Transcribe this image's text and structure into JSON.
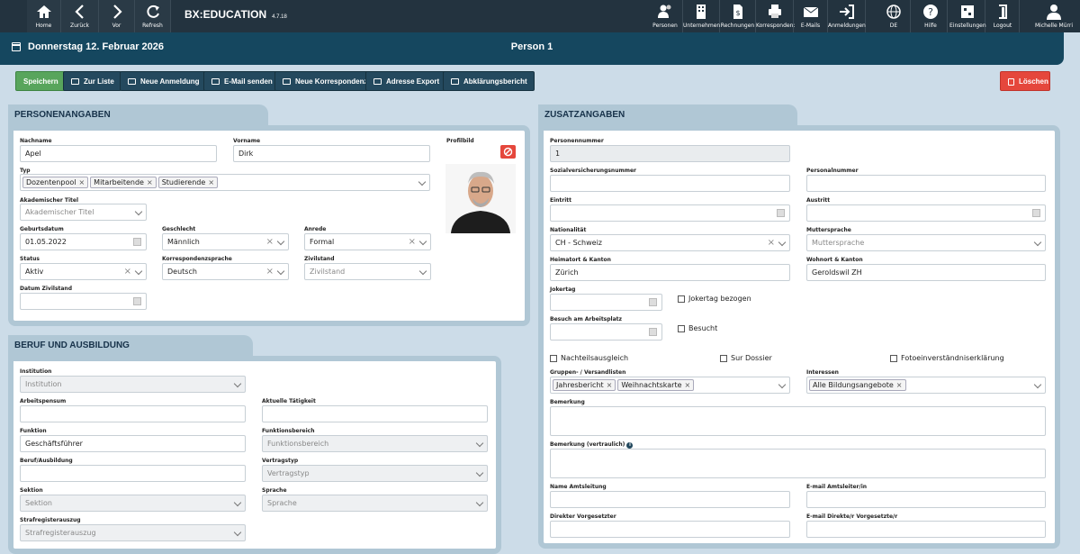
{
  "topbar": {
    "nav": [
      {
        "label": "Home",
        "icon": "home-icon"
      },
      {
        "label": "Zurück",
        "icon": "back-icon"
      },
      {
        "label": "Vor",
        "icon": "forward-icon"
      },
      {
        "label": "Refresh",
        "icon": "refresh-icon"
      }
    ],
    "brand": "BX:EDUCATION",
    "version": "4.7.18",
    "modules": [
      "Personen",
      "Unternehmen",
      "Rechnungen",
      "Korresponden:",
      "E-Mails",
      "Anmeldungen"
    ],
    "right": [
      "DE",
      "Hilfe",
      "Einstellungen",
      "Logout"
    ],
    "user": "Michelle Mürri"
  },
  "header": {
    "date": "Donnerstag 12. Februar 2026",
    "title": "Person 1"
  },
  "toolbar": {
    "save": "Speichern",
    "to_list": "Zur Liste",
    "new_registration": "Neue Anmeldung",
    "send_email": "E-Mail senden",
    "new_correspondence": "Neue Korrespondenz",
    "export_address": "Adresse Export",
    "clarification_report": "Abklärungsbericht",
    "delete": "Löschen"
  },
  "personal": {
    "title": "PERSONENANGABEN",
    "labels": {
      "lastname": "Nachname",
      "firstname": "Vorname",
      "profile": "Profilbild",
      "type": "Typ",
      "title": "Akademischer Titel",
      "birth": "Geburtsdatum",
      "gender": "Geschlecht",
      "salutation": "Anrede",
      "status": "Status",
      "corr_lang": "Korrespondenzsprache",
      "civil": "Zivilstand",
      "civil_date": "Datum Zivilstand"
    },
    "values": {
      "lastname": "Apel",
      "firstname": "Dirk",
      "type": [
        "Dozentenpool",
        "Mitarbeitende",
        "Studierende"
      ],
      "title_ph": "Akademischer Titel",
      "birth": "01.05.2022",
      "gender": "Männlich",
      "salutation": "Formal",
      "status": "Aktiv",
      "corr_lang": "Deutsch",
      "civil_ph": "Zivilstand"
    }
  },
  "job": {
    "title": "BERUF UND AUSBILDUNG",
    "labels": {
      "institution": "Institution",
      "workload": "Arbeitspensum",
      "current": "Aktuelle Tätigkeit",
      "function": "Funktion",
      "area": "Funktionsbereich",
      "profession": "Beruf/Ausbildung",
      "contract": "Vertragstyp",
      "section": "Sektion",
      "language": "Sprache",
      "criminal": "Strafregisterauszug"
    },
    "values": {
      "institution_ph": "Institution",
      "function": "Geschäftsführer",
      "area_ph": "Funktionsbereich",
      "contract_ph": "Vertragstyp",
      "section_ph": "Sektion",
      "language_ph": "Sprache",
      "criminal_ph": "Strafregisterauszug"
    }
  },
  "extra": {
    "title": "ZUSATZANGABEN",
    "labels": {
      "person_no": "Personennummer",
      "ssn": "Sozialversicherungsnummer",
      "staff_no": "Personalnummer",
      "entry": "Eintritt",
      "exit": "Austritt",
      "nationality": "Nationalität",
      "mother_tongue": "Muttersprache",
      "hometown": "Heimatort & Kanton",
      "residence": "Wohnort & Kanton",
      "joker": "Jokertag",
      "joker_taken": "Jokertag bezogen",
      "visit": "Besuch am Arbeitsplatz",
      "visited": "Besucht",
      "disadv": "Nachteilsausgleich",
      "dossier": "Sur Dossier",
      "photo": "Fotoeinverständniserklärung",
      "groups": "Gruppen- / Versandlisten",
      "interests": "Interessen",
      "remark": "Bemerkung",
      "remark_conf": "Bemerkung (vertraulich)",
      "head": "Name Amtsleitung",
      "head_email": "E-mail Amtsleiter/in",
      "supervisor": "Direkter Vorgesetzter",
      "supervisor_email": "E-mail Direkte/r Vorgesetzte/r"
    },
    "values": {
      "person_no": "1",
      "nationality": "CH - Schweiz",
      "mother_ph": "Muttersprache",
      "hometown": "Zürich",
      "residence": "Geroldswil ZH",
      "groups": [
        "Jahresbericht",
        "Weihnachtskarte"
      ],
      "interests": [
        "Alle Bildungsangebote"
      ]
    }
  }
}
